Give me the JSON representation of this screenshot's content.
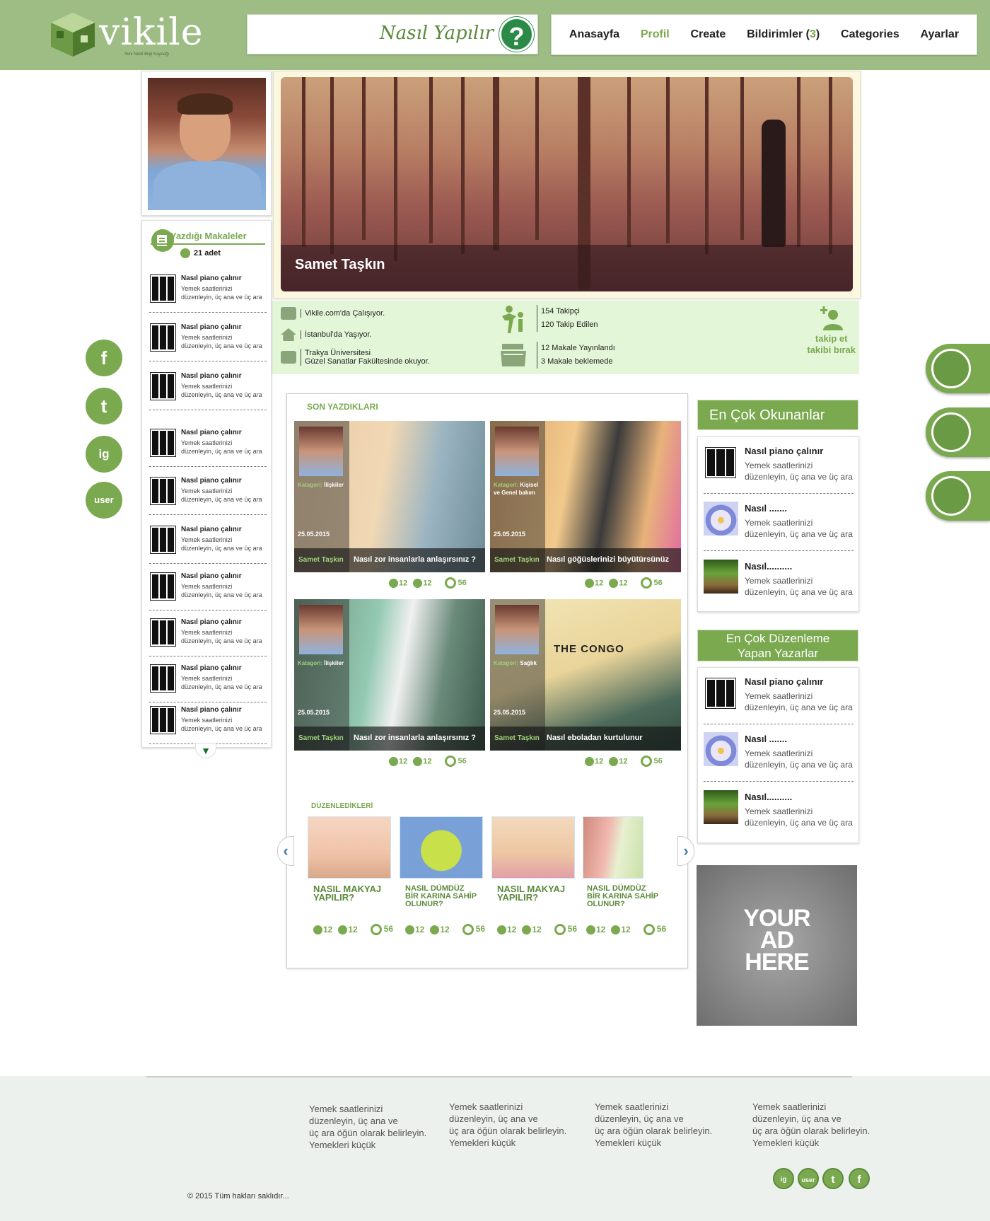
{
  "brand": {
    "name": "vikile",
    "tagline": "Yeni Nesil Bilgi Kaynağı",
    "howto": "Nasıl Yapılır",
    "howto_mark": "?"
  },
  "nav": {
    "items": [
      "Anasayfa",
      "Profil",
      "Create",
      "Bildirimler (",
      "Categories",
      "Ayarlar"
    ],
    "notif_count": "3",
    "notif_close": ")",
    "active": "Profil"
  },
  "profile": {
    "name": "Samet Taşkın",
    "work": "Vikile.com'da  Çalışıyor.",
    "home": "İstanbul'da Yaşıyor.",
    "school_1": "Trakya Üniversitesi",
    "school_2": "Güzel Sanatlar Fakültesinde okuyor.",
    "followers": "154 Takipçi",
    "following": "120 Takip Edilen",
    "published": "12 Makale Yayınlandı",
    "pending": "3 Makale beklemede",
    "follow_1": "takip et",
    "follow_2": "takibi bırak"
  },
  "written": {
    "title": "Yazdığı Makaleler",
    "count": "21 adet",
    "items": [
      {
        "title": "Nasıl piano çalınır",
        "desc_1": "Yemek saatlerinizi",
        "desc_2": "düzenleyin, üç ana ve üç ara"
      },
      {
        "title": "Nasıl piano çalınır",
        "desc_1": "Yemek saatlerinizi",
        "desc_2": "düzenleyin, üç ana ve üç ara"
      },
      {
        "title": "Nasıl piano çalınır",
        "desc_1": "Yemek saatlerinizi",
        "desc_2": "düzenleyin, üç ana ve üç ara"
      },
      {
        "title": "Nasıl piano çalınır",
        "desc_1": "Yemek saatlerinizi",
        "desc_2": "düzenleyin, üç ana ve üç ara"
      },
      {
        "title": "Nasıl piano çalınır",
        "desc_1": "Yemek saatlerinizi",
        "desc_2": "düzenleyin, üç ana ve üç ara"
      },
      {
        "title": "Nasıl piano çalınır",
        "desc_1": "Yemek saatlerinizi",
        "desc_2": "düzenleyin, üç ana ve üç ara"
      },
      {
        "title": "Nasıl piano çalınır",
        "desc_1": "Yemek saatlerinizi",
        "desc_2": "düzenleyin, üç ana ve üç ara"
      },
      {
        "title": "Nasıl piano çalınır",
        "desc_1": "Yemek saatlerinizi",
        "desc_2": "düzenleyin, üç ana ve üç ara"
      },
      {
        "title": "Nasıl piano çalınır",
        "desc_1": "Yemek saatlerinizi",
        "desc_2": "düzenleyin, üç ana ve üç ara"
      },
      {
        "title": "Nasıl piano çalınır",
        "desc_1": "Yemek saatlerinizi",
        "desc_2": "düzenleyin, üç ana ve üç ara"
      }
    ]
  },
  "social": [
    "f",
    "t",
    "ig",
    "user"
  ],
  "tools": [
    "edit-icon",
    "dice-icon",
    "brush-cup-icon"
  ],
  "recent": {
    "label": "SON YAZDIKLARI",
    "cards": [
      {
        "cat_label": "Katagori:",
        "cat": "İlişkiler",
        "date": "25.05.2015",
        "author": "Samet Taşkın",
        "title": "Nasıl zor insanlarla anlaşırsınız ?",
        "fb": "12",
        "tw": "12",
        "views": "56"
      },
      {
        "cat_label": "Katagori:",
        "cat": "Kişisel",
        "cat2": "ve Genel bakım",
        "date": "25.05.2015",
        "author": "Samet Taşkın",
        "title": "Nasıl göğüslerinizi büyütürsünüz",
        "fb": "12",
        "tw": "12",
        "views": "56"
      },
      {
        "cat_label": "Katagori:",
        "cat": "İlişkiler",
        "date": "25.05.2015",
        "author": "Samet Taşkın",
        "title": "Nasıl zor insanlarla anlaşırsınız ?",
        "fb": "12",
        "tw": "12",
        "views": "56"
      },
      {
        "cat_label": "Katagori:",
        "cat": "Sağlık",
        "date": "25.05.2015",
        "author": "Samet Taşkın",
        "title": "Nasıl eboladan kurtulunur",
        "fb": "12",
        "tw": "12",
        "views": "56",
        "art_text": "THE CONGO"
      }
    ]
  },
  "edited": {
    "label": "DÜZENLEDİKLERİ",
    "items": [
      {
        "title_1": "NASIL MAKYAJ",
        "title_2": "YAPILIR?",
        "fb": "12",
        "tw": "12",
        "views": "56"
      },
      {
        "title_1": "NASIL DÜMDÜZ",
        "title_2": "BİR KARINA SAHİP",
        "title_3": "OLUNUR?",
        "fb": "12",
        "tw": "12",
        "views": "56"
      },
      {
        "title_1": "NASIL MAKYAJ",
        "title_2": "YAPILIR?",
        "fb": "12",
        "tw": "12",
        "views": "56"
      },
      {
        "title_1": "NASIL DÜMDÜZ",
        "title_2": "BİR KARINA SAHİP",
        "title_3": "OLUNUR?",
        "fb": "12",
        "tw": "12",
        "views": "56"
      }
    ]
  },
  "most_read": {
    "title": "En Çok  Okunanlar",
    "items": [
      {
        "title": "Nasıl piano çalınır",
        "desc_1": "Yemek saatlerinizi",
        "desc_2": "düzenleyin, üç ana ve üç ara"
      },
      {
        "title": "Nasıl .......",
        "desc_1": "Yemek saatlerinizi",
        "desc_2": "düzenleyin, üç ana ve üç ara"
      },
      {
        "title": "Nasıl..........",
        "desc_1": "Yemek saatlerinizi",
        "desc_2": "düzenleyin, üç ana ve üç ara"
      }
    ]
  },
  "top_editors": {
    "title_1": "En Çok  Düzenleme",
    "title_2": "Yapan Yazarlar",
    "items": [
      {
        "title": "Nasıl piano çalınır",
        "desc_1": "Yemek saatlerinizi",
        "desc_2": "düzenleyin, üç ana ve üç ara"
      },
      {
        "title": "Nasıl .......",
        "desc_1": "Yemek saatlerinizi",
        "desc_2": "düzenleyin, üç ana ve üç ara"
      },
      {
        "title": "Nasıl..........",
        "desc_1": "Yemek saatlerinizi",
        "desc_2": "düzenleyin, üç ana ve üç ara"
      }
    ]
  },
  "ad": {
    "line_1": "YOUR",
    "line_2": "AD",
    "line_3": "HERE"
  },
  "footer": {
    "cols": [
      {
        "l1": "Yemek saatlerinizi",
        "l2": "düzenleyin, üç ana ve",
        "l3": "üç ara öğün olarak belirleyin.",
        "l4": "Yemekleri küçük"
      },
      {
        "l1": "Yemek saatlerinizi",
        "l2": "düzenleyin, üç ana ve",
        "l3": "üç ara öğün olarak belirleyin.",
        "l4": "Yemekleri küçük"
      },
      {
        "l1": "Yemek saatlerinizi",
        "l2": "düzenleyin, üç ana ve",
        "l3": "üç ara öğün olarak belirleyin.",
        "l4": "Yemekleri küçük"
      },
      {
        "l1": "Yemek saatlerinizi",
        "l2": "düzenleyin, üç ana ve",
        "l3": "üç ara öğün olarak belirleyin.",
        "l4": "Yemekleri küçük"
      }
    ],
    "copyright": "©  2015 Tüm hakları saklıdır..."
  },
  "colors": {
    "header": "#9dbd85",
    "accent": "#7aa94f",
    "info_bg": "#e3f6d8",
    "footer_bg": "#edf1ee"
  }
}
